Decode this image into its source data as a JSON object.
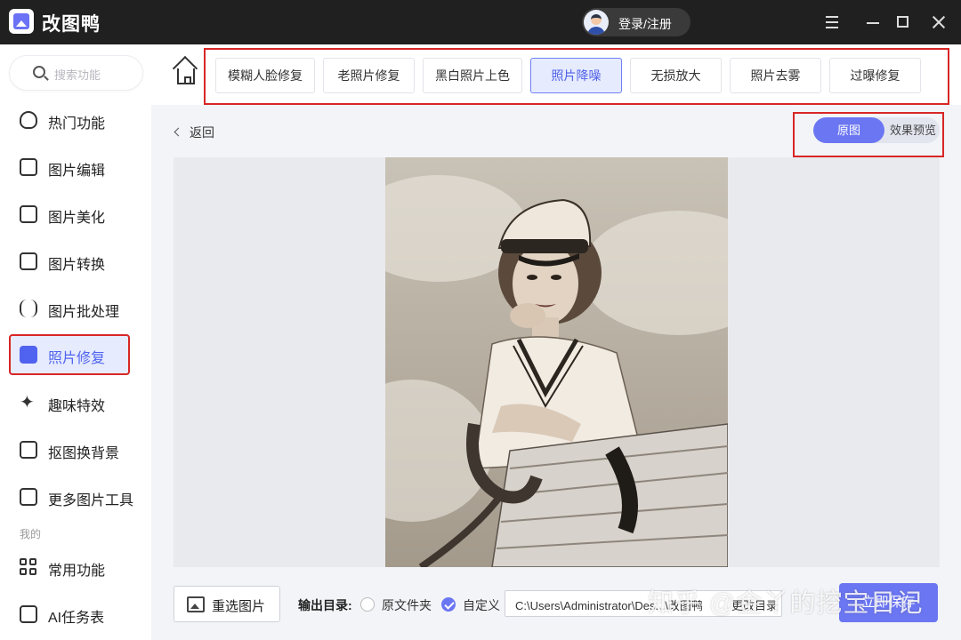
{
  "app": {
    "title": "改图鸭",
    "login_label": "登录/注册"
  },
  "sidebar": {
    "search_placeholder": "搜索功能",
    "items": [
      {
        "label": "热门功能",
        "icon": "fire-icon"
      },
      {
        "label": "图片编辑",
        "icon": "image-edit-icon"
      },
      {
        "label": "图片美化",
        "icon": "image-beautify-icon"
      },
      {
        "label": "图片转换",
        "icon": "image-convert-icon"
      },
      {
        "label": "图片批处理",
        "icon": "batch-icon"
      },
      {
        "label": "照片修复",
        "icon": "photo-repair-icon",
        "active": true
      },
      {
        "label": "趣味特效",
        "icon": "sparkle-icon"
      },
      {
        "label": "抠图换背景",
        "icon": "cutout-icon"
      },
      {
        "label": "更多图片工具",
        "icon": "toolbox-icon"
      }
    ],
    "section_mine": "我的",
    "mine_items": [
      {
        "label": "常用功能",
        "icon": "grid-icon"
      },
      {
        "label": "AI任务表",
        "icon": "ai-task-icon"
      }
    ]
  },
  "toolbar": {
    "tabs": [
      "模糊人脸修复",
      "老照片修复",
      "黑白照片上色",
      "照片降噪",
      "无损放大",
      "照片去雾",
      "过曝修复"
    ],
    "active_tab": "照片降噪"
  },
  "content": {
    "back_label": "返回",
    "toggle_original": "原图",
    "toggle_preview": "效果预览"
  },
  "bottom": {
    "reselect_label": "重选图片",
    "output_label": "输出目录:",
    "radio_source": "原文件夹",
    "radio_custom": "自定义",
    "path": "C:\\Users\\Administrator\\Des...\\改图鸭",
    "change_dir": "更改目录",
    "save_label": "立即保存"
  },
  "watermark": "知乎 @金丫的挖宝日记",
  "colors": {
    "accent": "#6b76f2",
    "highlight_frame": "#d82626",
    "titlebar": "#202020"
  }
}
